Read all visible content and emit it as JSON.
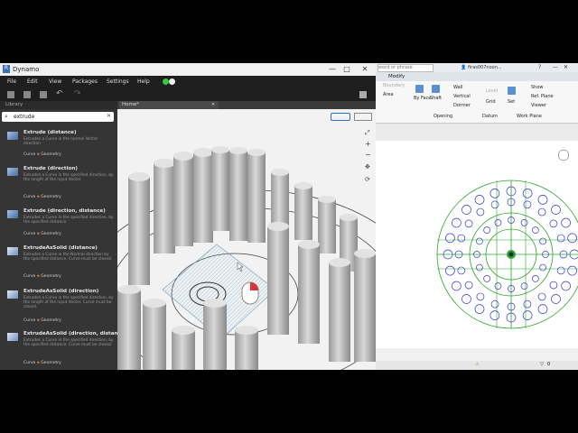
{
  "dynamo": {
    "title": "Dynamo",
    "menu": [
      "File",
      "Edit",
      "View",
      "Packages",
      "Settings",
      "Help"
    ],
    "library_label": "Library",
    "search_value": "extrude",
    "tab_label": "Home*",
    "items": [
      {
        "title": "Extrude (distance)",
        "desc": "Extrudes a Curve in the normal Vector direction",
        "cat1": "Curve",
        "cat2": "Geometry"
      },
      {
        "title": "Extrude (direction)",
        "desc": "Extrudes a Curve in the specified direction, by the length of the input Vector",
        "cat1": "Curve",
        "cat2": "Geometry"
      },
      {
        "title": "Extrude (direction, distance)",
        "desc": "Extrudes a Curve in the specified direction, by the specified distance",
        "cat1": "Curve",
        "cat2": "Geometry"
      },
      {
        "title": "ExtrudeAsSolid (distance)",
        "desc": "Extrudes a Curve in the Normal direction by the specified distance. Curve must be closed.",
        "cat1": "Curve",
        "cat2": "Geometry"
      },
      {
        "title": "ExtrudeAsSolid (direction)",
        "desc": "Extrudes a Curve in the specified direction, by the length of the input Vector. Curve must be closed.",
        "cat1": "Curve",
        "cat2": "Geometry"
      },
      {
        "title": "ExtrudeAsSolid (direction, distanc",
        "desc": "Extrudes a Curve in the specified direction, by the specified distance. Curve must be closed.",
        "cat1": "Curve",
        "cat2": "Geometry"
      }
    ]
  },
  "revit": {
    "search_placeholder": "word or phrase",
    "user": "firas007noon...",
    "tab": "Modify",
    "ribbon": {
      "by_face": "By Face",
      "shaft": "Shaft",
      "wall": "Wall",
      "vertical": "Vertical",
      "dormer": "Dormer",
      "level": "Level",
      "grid": "Grid",
      "set": "Set",
      "show": "Show",
      "ref_plane": "Ref. Plane",
      "viewer": "Viewer",
      "area": "Area",
      "opening": "Opening",
      "datum": "Datum",
      "work_plane": "Work Plane",
      "boundary": "Boundary"
    },
    "status_count": "0"
  },
  "colors": {
    "dynamo_bg": "#2b2b2b",
    "revit_green": "#2aa82a",
    "revit_blue": "#3838c8"
  }
}
